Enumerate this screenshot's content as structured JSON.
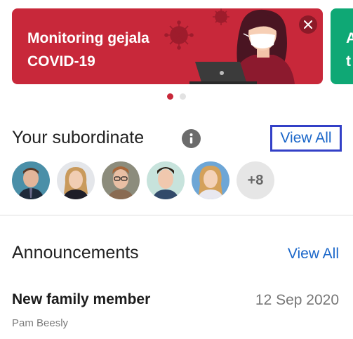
{
  "banner": {
    "title": "Monitoring gejala COVID-19",
    "bg_color": "#c8283a",
    "close_icon": "close-icon"
  },
  "banner_next": {
    "title_partial": "A\nt",
    "bg_color": "#0fa875"
  },
  "carousel": {
    "page_count": 2,
    "active_index": 0
  },
  "subordinates": {
    "title": "Your subordinate",
    "info_icon": "info-icon",
    "view_all_label": "View All",
    "more_count_label": "+8"
  },
  "announcements": {
    "title": "Announcements",
    "view_all_label": "View All",
    "items": [
      {
        "title": "New family member",
        "date": "12 Sep 2020",
        "author": "Pam Beesly"
      }
    ]
  },
  "colors": {
    "link": "#1a66c9",
    "highlight_box": "#3340c7",
    "accent": "#c8283a"
  }
}
